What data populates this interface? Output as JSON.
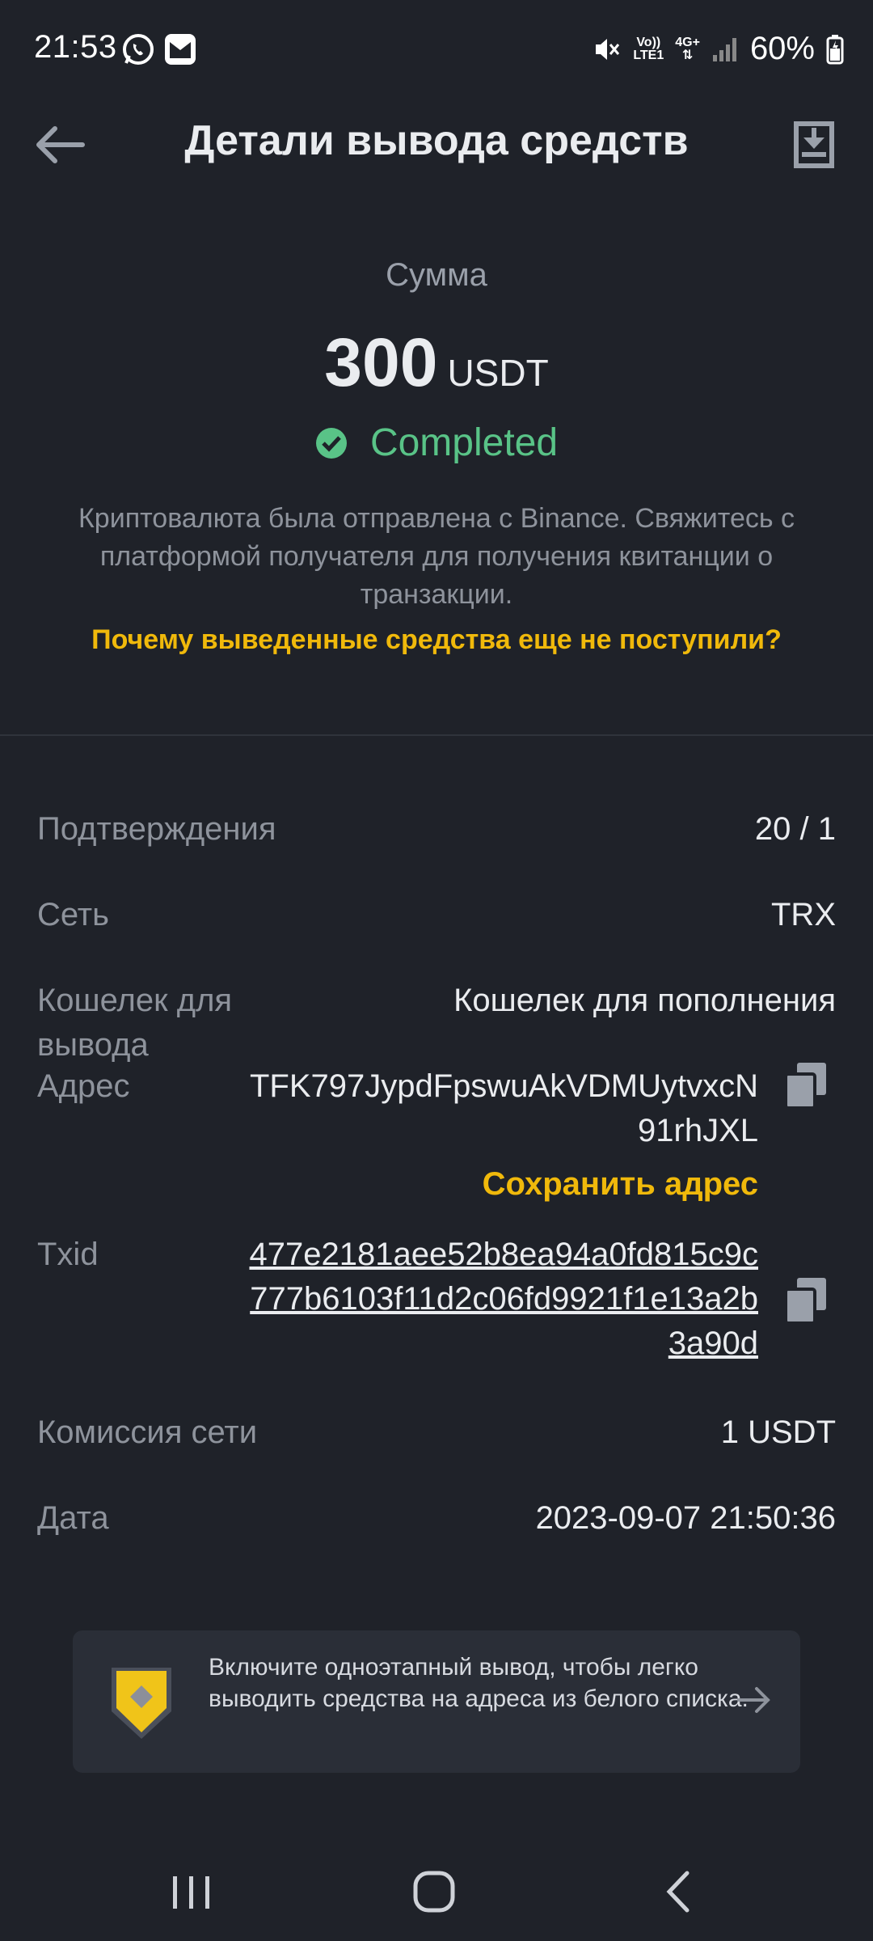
{
  "status_bar": {
    "time": "21:53",
    "battery": "60%",
    "network_top": "Vo))",
    "network_bottom": "LTE1",
    "network_gen": "4G+"
  },
  "header": {
    "title": "Детали вывода средств"
  },
  "amount": {
    "label": "Сумма",
    "value": "300",
    "unit": "USDT",
    "status": "Completed",
    "description": "Криптовалюта была отправлена с Binance. Свяжитесь с платформой получателя для получения квитанции о транзакции.",
    "why_link": "Почему выведенные средства еще не поступили?"
  },
  "details": {
    "confirmations_label": "Подтверждения",
    "confirmations_value": "20 / 1",
    "network_label": "Сеть",
    "network_value": "TRX",
    "wallet_label": "Кошелек для вывода",
    "wallet_value": "Кошелек для пополнения",
    "address_label": "Адрес",
    "address_value": "TFK797JypdFpswuAkVDMUytvxcN91rhJXL",
    "save_address": "Сохранить адрес",
    "txid_label": "Txid",
    "txid_value": "477e2181aee52b8ea94a0fd815c9c777b6103f11d2c06fd9921f1e13a2b3a90d",
    "fee_label": "Комиссия сети",
    "fee_value": "1 USDT",
    "date_label": "Дата",
    "date_value": "2023-09-07 21:50:36"
  },
  "promo": {
    "text": "Включите одноэтапный вывод, чтобы легко выводить средства на адреса из белого списка."
  },
  "colors": {
    "background": "#1f2229",
    "accent": "#f0b90b",
    "success": "#59c387",
    "muted": "#8e939c"
  },
  "icons": [
    "back-arrow-icon",
    "download-icon",
    "check-circle-icon",
    "copy-icon",
    "shield-icon",
    "arrow-right-icon",
    "recents-icon",
    "home-icon",
    "back-icon"
  ]
}
